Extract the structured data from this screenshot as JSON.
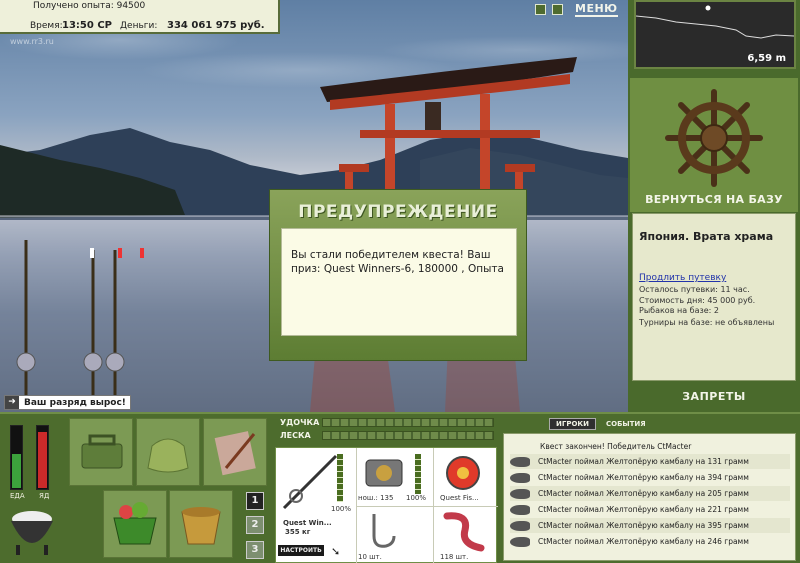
{
  "top_info": {
    "experience": "Получено опыта: 94500",
    "time_label": "Время:",
    "time_value": "13:50 СР",
    "money_label": "Деньги:",
    "money_value": "334 061 975 руб.",
    "watermark": "www.rr3.ru"
  },
  "controls": {
    "menu_label": "МЕНЮ",
    "icons": [
      "pause-icon",
      "sound-icon"
    ]
  },
  "dialog": {
    "title": "ПРЕДУПРЕЖДЕНИЕ",
    "message": "Вы стали победителем квеста! Ваш приз: Quest Winners-6, 180000 , Опыта"
  },
  "rank_badge": "Ваш разряд вырос!",
  "depth": "6,59 m",
  "right_panel": {
    "back_button": "ВЕРНУТЬСЯ НА БАЗУ",
    "location_title": "Япония. Врата храма",
    "extend_link": "Продлить путевку",
    "lines": [
      "Осталось путевки: 11 час.",
      "Стоимость дня: 45 000 руб.",
      "Рыбаков на базе: 2",
      "Турниры на базе: не объявлены"
    ],
    "bans_button": "ЗАПРЕТЫ"
  },
  "meters": {
    "food_label": "ЕДА",
    "poison_label": "ЯД",
    "food_level": 0.55,
    "poison_level": 0.92
  },
  "counters": [
    "1",
    "2",
    "3"
  ],
  "tackle": {
    "rod_label": "УДОЧКА",
    "line_label": "ЛЕСКА",
    "rod_name": "Quest Win...",
    "rod_weight": "355 кг",
    "rod_percent": "100%",
    "reel_info": "нош.: 135",
    "reel_percent": "100%",
    "line_name": "Quest Fis...",
    "hook_count": "10 шт.",
    "bait_count": "118 шт.",
    "setup_button": "НАСТРОИТЬ"
  },
  "events": {
    "tabs": [
      "ИГРОКИ",
      "СОБЫТИЯ"
    ],
    "header": "Квест закончен! Победитель CtMacter",
    "rows": [
      "CtMacter поймал Желтопёрую камбалу на 131 грамм",
      "CtMacter поймал Желтопёрую камбалу на 394 грамм",
      "CtMacter поймал Желтопёрую камбалу на 205 грамм",
      "CtMacter поймал Желтопёрую камбалу на 221 грамм",
      "CtMacter поймал Желтопёрую камбалу на 395 грамм",
      "CtMacter поймал Желтопёрую камбалу на 246 грамм"
    ]
  }
}
